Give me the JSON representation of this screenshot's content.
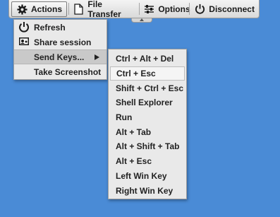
{
  "toolbar": {
    "actions_label": "Actions",
    "file_transfer_label": "File Transfer",
    "options_label": "Options",
    "disconnect_label": "Disconnect"
  },
  "actions_menu": {
    "items": [
      {
        "label": "Refresh",
        "icon": "power-icon"
      },
      {
        "label": "Share session",
        "icon": "share-session-icon"
      },
      {
        "label": "Send Keys...",
        "icon": "none"
      },
      {
        "label": "Take Screenshot",
        "icon": "none"
      }
    ]
  },
  "send_keys_menu": {
    "items": [
      "Ctrl + Alt + Del",
      "Ctrl + Esc",
      "Shift + Ctrl + Esc",
      "Shell Explorer",
      "Run",
      "Alt + Tab",
      "Alt + Shift + Tab",
      "Alt + Esc",
      "Left Win Key",
      "Right Win Key"
    ]
  },
  "colors": {
    "desktop_background": "#4a8bd6",
    "menu_background": "#e9e9e9",
    "selected_item": "#c9c9c9"
  }
}
